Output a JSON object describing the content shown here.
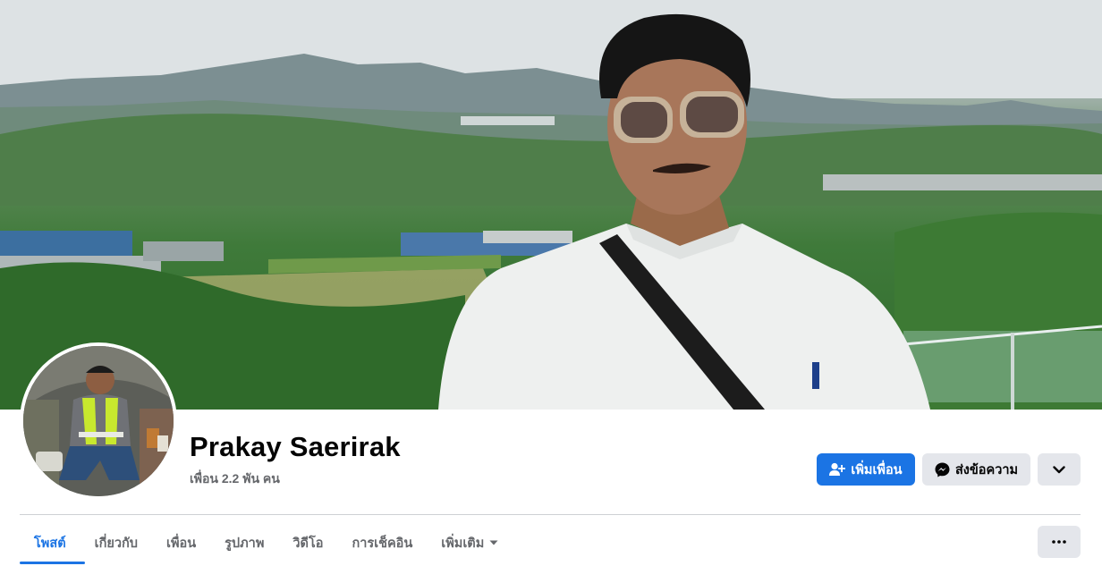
{
  "profile": {
    "name": "Prakay Saerirak",
    "friends_count": "เพื่อน 2.2 พัน คน"
  },
  "actions": {
    "add_friend_label": "เพิ่มเพื่อน",
    "message_label": "ส่งข้อความ"
  },
  "tabs": [
    {
      "label": "โพสต์",
      "active": true
    },
    {
      "label": "เกี่ยวกับ",
      "active": false
    },
    {
      "label": "เพื่อน",
      "active": false
    },
    {
      "label": "รูปภาพ",
      "active": false
    },
    {
      "label": "วิดีโอ",
      "active": false
    },
    {
      "label": "การเช็คอิน",
      "active": false
    },
    {
      "label": "เพิ่มเติม",
      "active": false
    }
  ],
  "colors": {
    "accent": "#1b74e4",
    "secondary_button": "#e4e6eb",
    "muted_text": "#65676b"
  },
  "icons": {
    "add_friend": "person-plus-icon",
    "message": "messenger-icon",
    "more_dropdown": "chevron-down-icon",
    "tab_more": "caret-down-icon",
    "options": "more-horizontal-icon"
  }
}
